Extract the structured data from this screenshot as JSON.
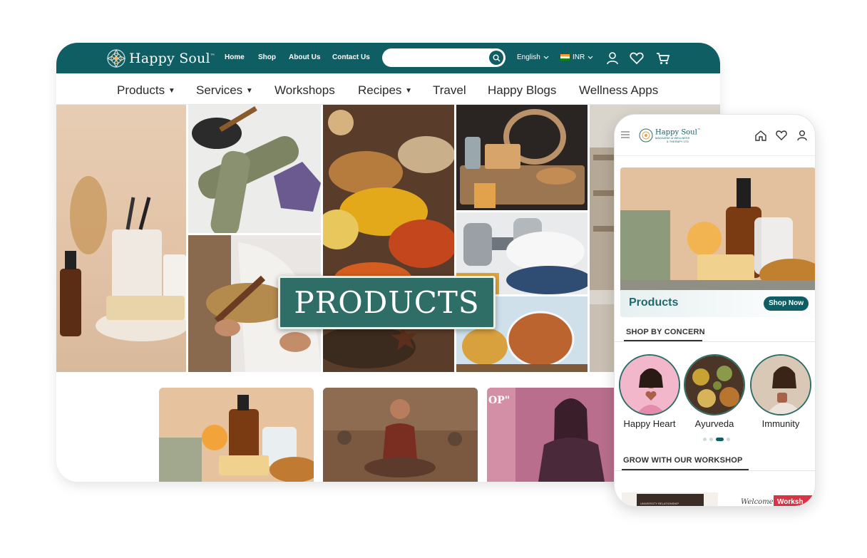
{
  "desktop": {
    "brand": "Happy Soul",
    "brand_tm": "™",
    "top_nav": [
      "Home",
      "Shop",
      "About Us",
      "Contact Us"
    ],
    "search": {
      "placeholder": ""
    },
    "language": "English",
    "currency": "INR",
    "icons": [
      "user-icon",
      "heart-icon",
      "cart-icon"
    ],
    "sub_nav": [
      {
        "label": "Products",
        "has_dropdown": true
      },
      {
        "label": "Services",
        "has_dropdown": true
      },
      {
        "label": "Workshops",
        "has_dropdown": false
      },
      {
        "label": "Recipes",
        "has_dropdown": true
      },
      {
        "label": "Travel",
        "has_dropdown": false
      },
      {
        "label": "Happy Blogs",
        "has_dropdown": false
      },
      {
        "label": "Wellness Apps",
        "has_dropdown": false
      }
    ],
    "banner_label": "PRODUCTS",
    "card_overlay_text": "OP\""
  },
  "mobile": {
    "brand": "Happy Soul",
    "brand_tm": "™",
    "tagline_line1": "MAGAZINE of WELLNESS",
    "tagline_line2": "& THERAPY LTD",
    "hero_title": "Products",
    "hero_button": "Shop Now",
    "section_concern": "SHOP BY CONCERN",
    "concerns": [
      "Happy Heart",
      "Ayurveda",
      "Immunity"
    ],
    "carousel": {
      "pages": 4,
      "active_page": 3
    },
    "section_workshop": "GROW WITH OUR WORKSHOP",
    "workshop_preview": {
      "left_text": "UNIVERSITY RELATIONSHIP",
      "right_word1": "Welcome",
      "right_word2": "Worksh"
    }
  },
  "colors": {
    "brand_teal": "#0f5e64",
    "banner_green": "#2f6e67",
    "text_dark": "#2b2b2b"
  }
}
